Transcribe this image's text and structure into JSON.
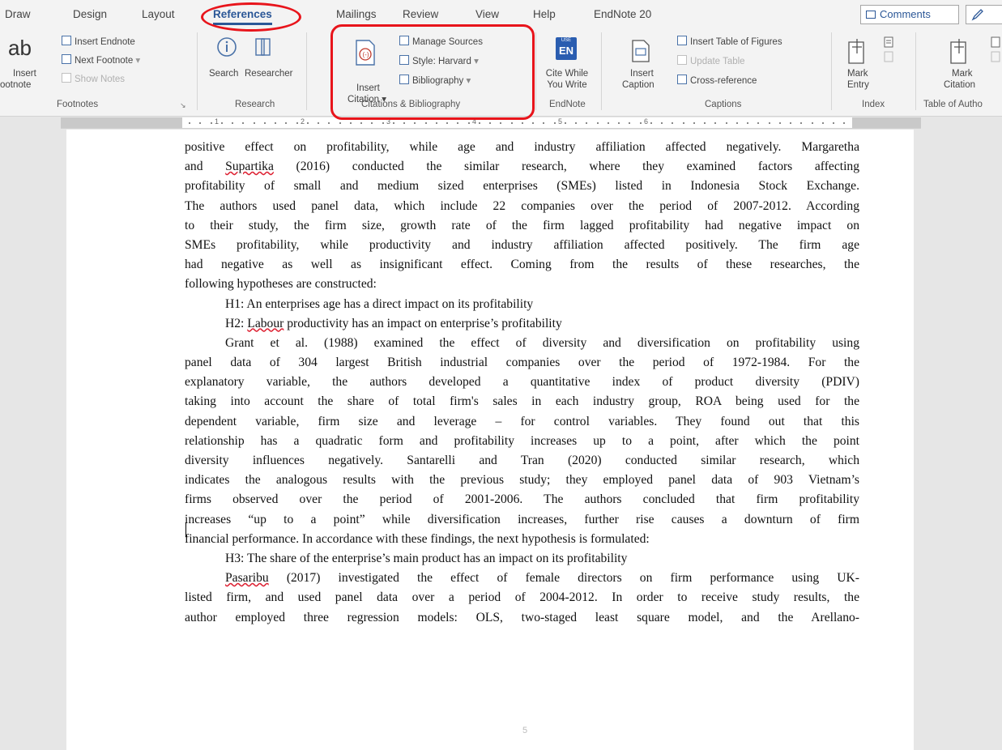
{
  "tabs": [
    {
      "label": "Draw"
    },
    {
      "label": "Design"
    },
    {
      "label": "Layout"
    },
    {
      "label": "References",
      "active": true
    },
    {
      "label": "Mailings"
    },
    {
      "label": "Review"
    },
    {
      "label": "View"
    },
    {
      "label": "Help"
    },
    {
      "label": "EndNote 20"
    }
  ],
  "top_buttons": {
    "comments": "Comments"
  },
  "ribbon": {
    "footnotes": {
      "ab_glyph": "ab",
      "insert_footnote_1": "Insert",
      "insert_footnote_2": "ootnote",
      "insert_endnote": "Insert Endnote",
      "next_footnote": "Next Footnote",
      "show_notes": "Show Notes",
      "label": "Footnotes"
    },
    "research": {
      "search": "Search",
      "researcher": "Researcher",
      "label": "Research"
    },
    "citations": {
      "insert_citation_1": "Insert",
      "insert_citation_2": "Citation",
      "manage_sources": "Manage Sources",
      "style_label": "Style:",
      "style_value": "Harvard",
      "bibliography": "Bibliography",
      "label": "Citations & Bibliography"
    },
    "endnote": {
      "logo": "EN",
      "logo_top": "USE",
      "cite_1": "Cite While",
      "cite_2": "You Write",
      "label": "EndNote"
    },
    "captions": {
      "insert_caption_1": "Insert",
      "insert_caption_2": "Caption",
      "insert_table_of_figures": "Insert Table of Figures",
      "update_table": "Update Table",
      "cross_reference": "Cross-reference",
      "label": "Captions"
    },
    "index": {
      "mark_entry_1": "Mark",
      "mark_entry_2": "Entry",
      "label": "Index"
    },
    "authorities": {
      "mark_citation_1": "Mark",
      "mark_citation_2": "Citation",
      "label": "Table of Autho"
    }
  },
  "ruler": {
    "numbers": [
      "1",
      "2",
      "3",
      "4",
      "5",
      "6"
    ]
  },
  "document": {
    "lines": [
      {
        "text": "positive effect on profitability, while age and industry affiliation affected negatively. Margaretha",
        "j": true
      },
      {
        "pre": "and ",
        "sq": "Supartika",
        "text": " (2016) conducted the similar research, where they examined factors affecting",
        "j": true
      },
      {
        "text": "profitability of small and medium sized enterprises (SMEs) listed in Indonesia Stock Exchange.",
        "j": true
      },
      {
        "text": "The authors used panel data, which include 22 companies over the period of 2007-2012. According",
        "j": true
      },
      {
        "text": "to their study, the firm size, growth rate of the firm lagged profitability had negative impact on",
        "j": true
      },
      {
        "text": "SMEs profitability, while productivity and industry affiliation affected positively. The firm age",
        "j": true
      },
      {
        "text": "had negative as well as insignificant effect. Coming from the results of these researches, the",
        "j": true
      },
      {
        "text": "following hypotheses are constructed:"
      },
      {
        "text": "H1: An enterprises age has a direct impact on its profitability",
        "ind": true
      },
      {
        "pre": "H2: ",
        "sq": "Labour",
        "text": " productivity has an impact on enterprise’s profitability",
        "ind": true
      },
      {
        "text": "Grant et al. (1988) examined the effect of diversity and diversification on profitability using",
        "j": true,
        "ind": true
      },
      {
        "text": "panel data of 304 largest British industrial companies over the period of 1972-1984. For the",
        "j": true
      },
      {
        "text": "explanatory variable, the authors developed a quantitative index of product diversity (PDIV)",
        "j": true
      },
      {
        "text": "taking into account the share of total firm's sales in each industry group, ROA being used for the",
        "j": true
      },
      {
        "text": "dependent variable, firm size and leverage – for control variables. They found out that this",
        "j": true
      },
      {
        "text": "relationship has a quadratic form and profitability increases up to a point, after which the point",
        "j": true
      },
      {
        "text": "diversity influences negatively. Santarelli and Tran (2020) conducted similar research, which",
        "j": true
      },
      {
        "text": "indicates the analogous results with the previous study; they employed panel data of 903 Vietnam’s",
        "j": true
      },
      {
        "text": "firms observed over the period of 2001-2006. The authors concluded that firm profitability",
        "j": true
      },
      {
        "text": "increases “up to a point” while diversification increases, further rise causes a downturn of firm",
        "j": true
      },
      {
        "text": "financial performance. In accordance with these findings, the next hypothesis is formulated:"
      },
      {
        "text": "H3: The share of the enterprise’s main product has an impact on its profitability",
        "ind": true
      },
      {
        "pre": "",
        "sq": "Pasaribu",
        "text": " (2017) investigated the effect of female directors on firm performance using UK-",
        "j": true,
        "ind": true
      },
      {
        "text": "listed firm, and used panel data over a period of 2004-2012. In order to receive study results, the",
        "j": true
      },
      {
        "text": "author employed three regression models: OLS, two-staged least square model, and the Arellano-",
        "j": true
      }
    ],
    "page_number": "5"
  },
  "colors": {
    "annotation": "#e8141b",
    "accent": "#2b5797"
  }
}
